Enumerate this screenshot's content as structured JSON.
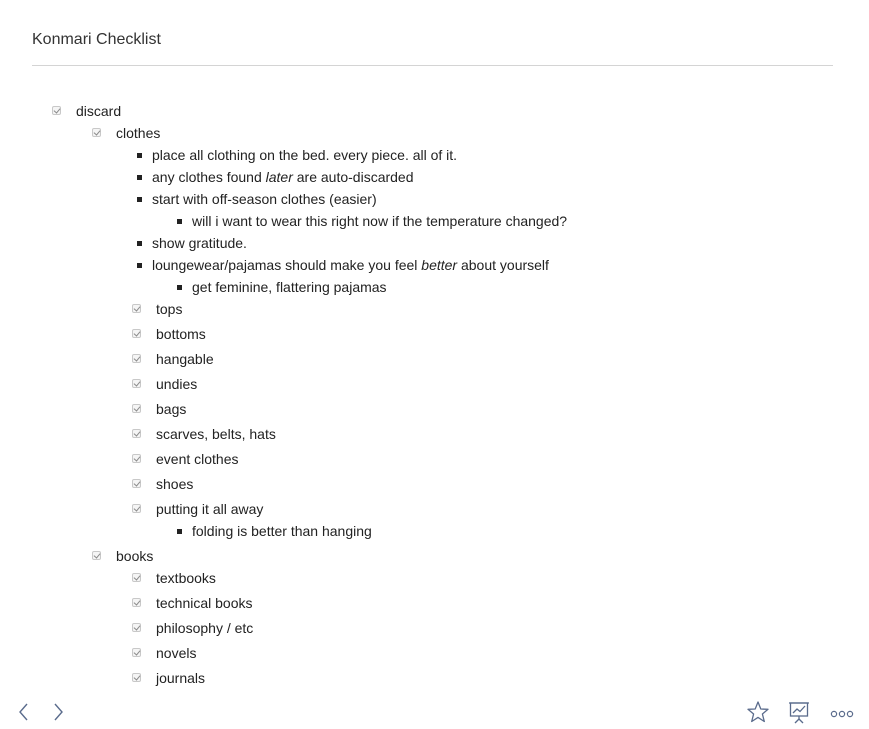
{
  "note": {
    "title": "Konmari Checklist"
  },
  "items": {
    "discard": "discard",
    "clothes": "clothes",
    "b1": "place all clothing on the bed. every piece. all of it.",
    "b2_pre": "any clothes found ",
    "b2_em": "later",
    "b2_post": " are auto-discarded",
    "b3": "start with off-season clothes (easier)",
    "b3a": "will i want to wear this right now if the temperature changed?",
    "b4": "show gratitude.",
    "b5_pre": "loungewear/pajamas should make you feel ",
    "b5_em": "better",
    "b5_post": " about yourself",
    "b5a": "get feminine, flattering pajamas",
    "tops": "tops",
    "bottoms": "bottoms",
    "hangable": "hangable",
    "undies": "undies",
    "bags": "bags",
    "scarves": "scarves, belts, hats",
    "event": "event clothes",
    "shoes": "shoes",
    "putting": "putting it all away",
    "folding": "folding is better than hanging",
    "books": "books",
    "textbooks": "textbooks",
    "technical": "technical books",
    "philosophy": "philosophy / etc",
    "novels": "novels",
    "journals": "journals"
  },
  "checkbox_state": "checked",
  "toolbar": {
    "back_icon": "chevron-left-icon",
    "forward_icon": "chevron-right-icon",
    "star_icon": "star-icon",
    "present_icon": "presentation-chart-icon",
    "more_icon": "more-dots-icon"
  },
  "colors": {
    "text": "#222222",
    "icon": "#5a6b8c",
    "rule": "#d4d4d4"
  }
}
